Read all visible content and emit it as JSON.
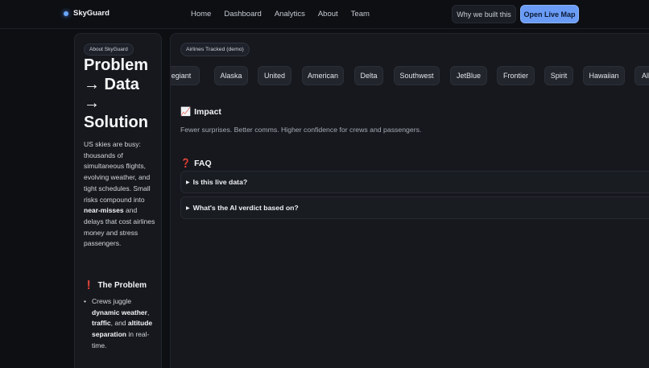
{
  "nav": {
    "brand": "SkyGuard",
    "links": [
      "Home",
      "Dashboard",
      "Analytics",
      "About",
      "Team"
    ],
    "why_label": "Why we built this",
    "open_label": "Open Live Map",
    "accent": "#6a9cf6"
  },
  "left": {
    "badge": "About SkyGuard",
    "hero_lines": [
      "Problem",
      "→ Data",
      "→",
      "Solution"
    ],
    "intro": {
      "part1": "US skies are busy: thousands of simultaneous flights, evolving weather, and tight schedules. Small risks compound into ",
      "bold": "near-misses",
      "part2": " and delays that cost airlines money and stress passengers."
    },
    "problem_icon": "exclamation-icon",
    "problem_title": "The Problem",
    "problem_item": {
      "t1": "Crews juggle ",
      "b1": "dynamic weather",
      "t2": ", ",
      "b2": "traffic",
      "t3": ", and ",
      "b3": "altitude separation",
      "t4": " in real-time."
    }
  },
  "main": {
    "airlines_badge": "Airlines Tracked (demo)",
    "airlines": [
      "egiant",
      "Alaska",
      "United",
      "American",
      "Delta",
      "Southwest",
      "JetBlue",
      "Frontier",
      "Spirit",
      "Hawaiian",
      "Allegiant"
    ],
    "impact_icon": "chart-up-icon",
    "impact_title": "Impact",
    "impact_text": "Fewer surprises. Better comms. Higher confidence for crews and passengers.",
    "faq_icon": "question-icon",
    "faq_title": "FAQ",
    "faq": [
      "Is this live data?",
      "What's the AI verdict based on?"
    ]
  }
}
